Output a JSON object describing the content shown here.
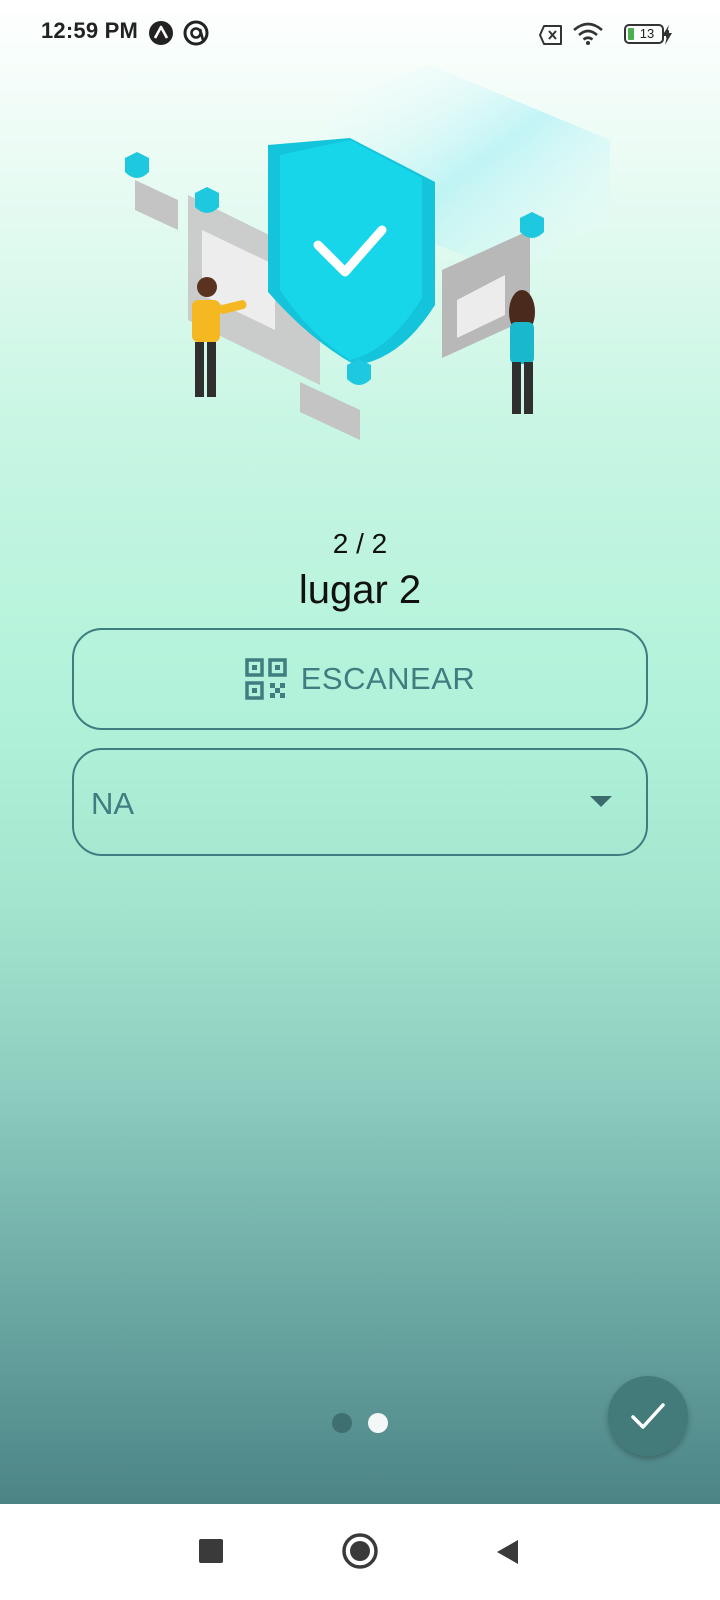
{
  "status_bar": {
    "time": "12:59 PM",
    "battery_level": "13",
    "icons": [
      "app-a-icon",
      "app-at-icon",
      "no-sim-icon",
      "wifi-icon",
      "battery-icon",
      "charging-icon"
    ]
  },
  "step": {
    "counter": "2 / 2",
    "title": "lugar 2"
  },
  "scan_button": {
    "label": "ESCANEAR",
    "icon": "qr-code-icon"
  },
  "dropdown": {
    "selected": "NA"
  },
  "pager": {
    "current_page": 2,
    "total_pages": 2
  },
  "fab": {
    "icon": "check-icon"
  },
  "nav": {
    "items": [
      "recents-square-icon",
      "home-circle-icon",
      "back-triangle-icon"
    ]
  },
  "colors": {
    "accent": "#3e7d80",
    "fab": "#437b7b",
    "shield": "#16d0e6"
  }
}
